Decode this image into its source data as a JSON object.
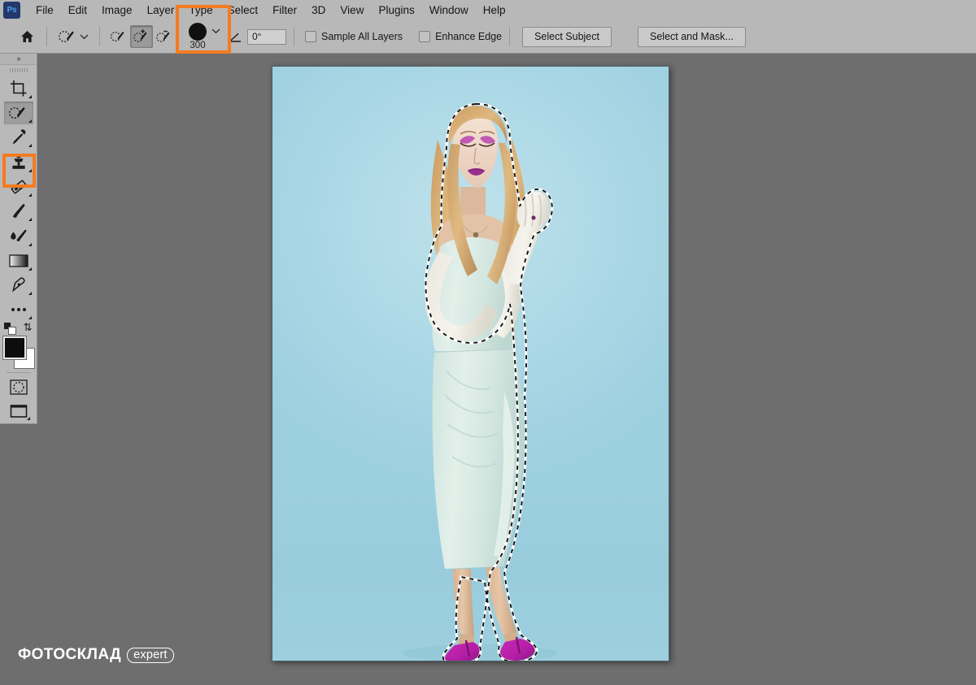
{
  "app": {
    "name": "Adobe Photoshop",
    "logo_text": "Ps"
  },
  "menubar": {
    "items": [
      {
        "label": "File"
      },
      {
        "label": "Edit"
      },
      {
        "label": "Image"
      },
      {
        "label": "Layer"
      },
      {
        "label": "Type"
      },
      {
        "label": "Select"
      },
      {
        "label": "Filter"
      },
      {
        "label": "3D"
      },
      {
        "label": "View"
      },
      {
        "label": "Plugins"
      },
      {
        "label": "Window"
      },
      {
        "label": "Help"
      }
    ]
  },
  "options_bar": {
    "home_icon": "home-icon",
    "tool_preset_icon": "quick-selection-icon",
    "tool_preset_chevron": "chevron-down-icon",
    "selection_modes": [
      {
        "name": "new-selection",
        "icon": "quick-selection-new-icon",
        "active": false
      },
      {
        "name": "add-to-selection",
        "icon": "quick-selection-add-icon",
        "active": true
      },
      {
        "name": "subtract-from-selection",
        "icon": "quick-selection-subtract-icon",
        "active": false
      }
    ],
    "brush": {
      "size": "300",
      "chevron": "chevron-down-icon",
      "highlighted": true,
      "highlight_color": "#f47b20"
    },
    "angle": {
      "icon": "angle-icon",
      "value": "0°"
    },
    "checkboxes": [
      {
        "label": "Sample All Layers",
        "checked": false
      },
      {
        "label": "Enhance Edge",
        "checked": false
      }
    ],
    "buttons": [
      {
        "label": "Select Subject"
      },
      {
        "label": "Select and Mask..."
      }
    ]
  },
  "toolbar": {
    "collapse_label": "»",
    "grip": "drag-handle",
    "tools": [
      {
        "name": "crop-tool",
        "icon": "crop-icon",
        "selected": false,
        "has_flyout": true
      },
      {
        "name": "quick-selection-tool",
        "icon": "quick-selection-icon",
        "selected": true,
        "has_flyout": true,
        "highlighted": true
      },
      {
        "name": "eyedropper-tool",
        "icon": "eyedropper-icon",
        "selected": false,
        "has_flyout": true
      },
      {
        "name": "clone-stamp-tool",
        "icon": "clone-stamp-icon",
        "selected": false,
        "has_flyout": true
      },
      {
        "name": "eraser-tool",
        "icon": "eraser-icon",
        "selected": false,
        "has_flyout": true
      },
      {
        "name": "brush-tool",
        "icon": "brush-icon",
        "selected": false,
        "has_flyout": true
      },
      {
        "name": "blur-tool",
        "icon": "blur-brush-icon",
        "selected": false,
        "has_flyout": true
      },
      {
        "name": "gradient-tool",
        "icon": "gradient-icon",
        "selected": false,
        "has_flyout": true
      },
      {
        "name": "pen-tool",
        "icon": "pen-icon",
        "selected": false,
        "has_flyout": true
      },
      {
        "name": "more-tools",
        "icon": "ellipsis-icon",
        "selected": false,
        "has_flyout": true
      }
    ],
    "colors": {
      "foreground": "#0d0d0d",
      "background": "#ffffff",
      "default_colors_icon": "default-colors-icon",
      "swap_colors_icon": "swap-colors-icon"
    },
    "quick_mask": {
      "name": "quick-mask-toggle",
      "icon": "quick-mask-icon"
    },
    "screen_mode": {
      "name": "screen-mode-toggle",
      "icon": "screen-mode-icon"
    },
    "highlight_color": "#f47b20"
  },
  "document": {
    "name": "model-photo-canvas",
    "selection_active": true,
    "selection_style": "marching-ants",
    "background_color": "#aed9e6",
    "subject": "woman in mint dress with long gloves and magenta heels"
  },
  "watermark": {
    "brand": "ФОТОСКЛАД",
    "badge": "expert",
    "color": "#ffffff"
  },
  "workspace": {
    "background_color": "#6e6e6e"
  }
}
